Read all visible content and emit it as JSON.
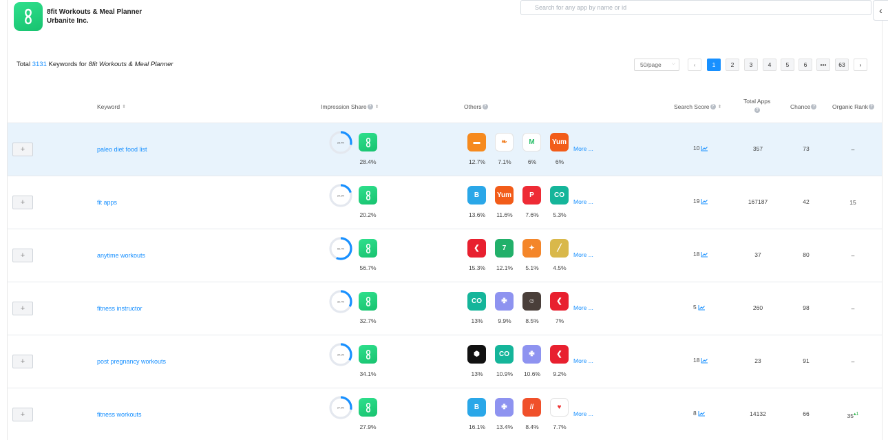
{
  "app": {
    "name": "8fit Workouts & Meal Planner",
    "developer": "Urbanite Inc.",
    "icon": "8fit-logo-icon",
    "brand_color": "#1fd17c"
  },
  "search": {
    "placeholder": "Search for any app by name or id"
  },
  "summary": {
    "prefix": "Total",
    "count": "3131",
    "middle": "Keywords for",
    "app_name": "8fit Workouts & Meal Planner"
  },
  "pagination": {
    "page_size": "50/page",
    "pages": [
      "1",
      "2",
      "3",
      "4",
      "5",
      "6",
      "•••",
      "63"
    ],
    "active": "1"
  },
  "columns": {
    "keyword": "Keyword",
    "impression_share": "Impression Share",
    "others": "Others",
    "search_score": "Search Score",
    "total_apps": "Total Apps",
    "chance": "Chance",
    "organic_rank": "Organic Rank"
  },
  "more_label": "More ...",
  "add_label": "+",
  "rows": [
    {
      "keyword": "paleo diet food list",
      "share": "28.4%",
      "share_value": 28.4,
      "donut_label": "28.4%",
      "others": [
        {
          "icon": "scale-app-icon",
          "color": "#f68a1e",
          "pct": "12.7%"
        },
        {
          "icon": "carrot-app-icon",
          "color": "#ffffff",
          "pct": "7.1%"
        },
        {
          "icon": "m-logo-app-icon",
          "color": "#ffffff",
          "pct": "6%"
        },
        {
          "icon": "yum-app-icon",
          "color": "#f25c19",
          "pct": "6%"
        }
      ],
      "score": "10",
      "total_apps": "357",
      "chance": "73",
      "rank": "–",
      "rank_change": ""
    },
    {
      "keyword": "fit apps",
      "share": "20.2%",
      "share_value": 20.2,
      "donut_label": "20.2%",
      "others": [
        {
          "icon": "b-fitness-app-icon",
          "color": "#2aa7e8",
          "pct": "13.6%"
        },
        {
          "icon": "yum-app-icon",
          "color": "#f25c19",
          "pct": "11.6%"
        },
        {
          "icon": "peloton-app-icon",
          "color": "#ee2b35",
          "pct": "7.6%"
        },
        {
          "icon": "co-app-icon",
          "color": "#15b59a",
          "pct": "5.3%"
        }
      ],
      "score": "19",
      "total_apps": "167187",
      "chance": "42",
      "rank": "15",
      "rank_change": ""
    },
    {
      "keyword": "anytime workouts",
      "share": "56.7%",
      "share_value": 56.7,
      "donut_label": "56.7%",
      "others": [
        {
          "icon": "red-arrow-app-icon",
          "color": "#e8202f",
          "pct": "15.3%"
        },
        {
          "icon": "seven-app-icon",
          "color": "#22b06a",
          "pct": "12.1%"
        },
        {
          "icon": "muscle-app-icon",
          "color": "#f4862a",
          "pct": "5.1%"
        },
        {
          "icon": "band-app-icon",
          "color": "#d9b84a",
          "pct": "4.5%"
        }
      ],
      "score": "18",
      "total_apps": "37",
      "chance": "80",
      "rank": "–",
      "rank_change": ""
    },
    {
      "keyword": "fitness instructor",
      "share": "32.7%",
      "share_value": 32.7,
      "donut_label": "32.7%",
      "others": [
        {
          "icon": "co-app-icon",
          "color": "#15b59a",
          "pct": "13%"
        },
        {
          "icon": "figure-app-icon",
          "color": "#8e93f0",
          "pct": "9.9%"
        },
        {
          "icon": "trainer-photo-app-icon",
          "color": "#4a3f3a",
          "pct": "8.5%"
        },
        {
          "icon": "red-arrow-app-icon",
          "color": "#e8202f",
          "pct": "7%"
        }
      ],
      "score": "5",
      "total_apps": "260",
      "chance": "98",
      "rank": "–",
      "rank_change": ""
    },
    {
      "keyword": "post pregnancy workouts",
      "share": "34.1%",
      "share_value": 34.1,
      "donut_label": "34.1%",
      "others": [
        {
          "icon": "octagon-app-icon",
          "color": "#111111",
          "pct": "13%"
        },
        {
          "icon": "co-app-icon",
          "color": "#15b59a",
          "pct": "10.9%"
        },
        {
          "icon": "figure-app-icon",
          "color": "#8e93f0",
          "pct": "10.6%"
        },
        {
          "icon": "red-arrow-app-icon",
          "color": "#e8202f",
          "pct": "9.2%"
        }
      ],
      "score": "18",
      "total_apps": "23",
      "chance": "91",
      "rank": "–",
      "rank_change": ""
    },
    {
      "keyword": "fitness workouts",
      "share": "27.9%",
      "share_value": 27.9,
      "donut_label": "27.9%",
      "others": [
        {
          "icon": "b-fitness-app-icon",
          "color": "#2aa7e8",
          "pct": "16.1%"
        },
        {
          "icon": "figure-app-icon",
          "color": "#8e93f0",
          "pct": "13.4%"
        },
        {
          "icon": "slash-app-icon",
          "color": "#f0502a",
          "pct": "8.4%"
        },
        {
          "icon": "heart-app-icon",
          "color": "#ffffff",
          "pct": "7.7%"
        }
      ],
      "score": "8",
      "total_apps": "14132",
      "chance": "66",
      "rank": "35",
      "rank_change": "1"
    }
  ]
}
